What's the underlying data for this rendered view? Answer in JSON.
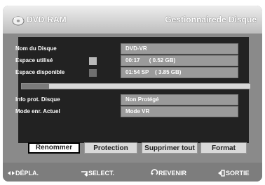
{
  "header": {
    "app_title": "DVD-RAM",
    "menu_title": "Gestionnairede Disque"
  },
  "disc_info": {
    "rows": [
      {
        "label": "Nom du Disque",
        "value": "DVD-VR"
      },
      {
        "label": "Espace utilisé",
        "value": "00:17      ( 0.52 GB)"
      },
      {
        "label": "Espace disponible",
        "value": "01:54 SP    ( 3.85 GB)"
      }
    ],
    "usage_fraction": 0.12
  },
  "disc_state": {
    "rows": [
      {
        "label": "Info prot. Disque",
        "value": "Non Protégé"
      },
      {
        "label": "Mode enr. Actuel",
        "value": "Mode VR"
      }
    ]
  },
  "buttons": {
    "rename": "Renommer",
    "protect": "Protection",
    "delete_all": "Supprimer tout",
    "format": "Format"
  },
  "footer": {
    "move": "DÉPLA.",
    "select": "SELECT.",
    "return": "REVENIR",
    "exit": "SORTIE"
  }
}
